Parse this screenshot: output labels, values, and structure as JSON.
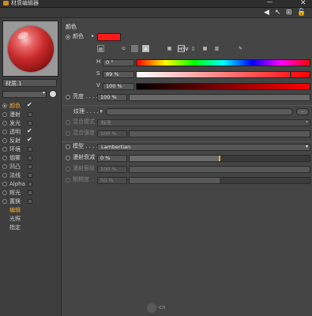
{
  "window": {
    "title": "材质编辑器",
    "buttons": {
      "minimize": "－",
      "close": "✕"
    }
  },
  "toolbar": {
    "back": "◀",
    "arrow": "↖",
    "pin": "⊞",
    "lock": "🔓"
  },
  "material": {
    "name": "材质.1"
  },
  "channels": [
    {
      "label": "颜色",
      "checked": true,
      "active": true
    },
    {
      "label": "漫射",
      "checked": false
    },
    {
      "label": "发光",
      "checked": false
    },
    {
      "label": "透明",
      "checked": true
    },
    {
      "label": "反射",
      "checked": true
    },
    {
      "label": "环境",
      "checked": false
    },
    {
      "label": "烟雾",
      "checked": false
    },
    {
      "label": "凹凸",
      "checked": false
    },
    {
      "label": "法线",
      "checked": false
    },
    {
      "label": "Alpha",
      "checked": false
    },
    {
      "label": "辉光",
      "checked": false
    },
    {
      "label": "置换",
      "checked": false
    }
  ],
  "subitems": [
    {
      "label": "编辑",
      "active": true
    },
    {
      "label": "光照",
      "active": false
    },
    {
      "label": "指定",
      "active": false
    }
  ],
  "color_section": {
    "title": "颜色",
    "color_label": "颜色",
    "color_hex": "#ff1a1a",
    "h_label": "H",
    "h_value": "0 °",
    "s_label": "S",
    "s_value": "89 %",
    "s_fraction": 0.89,
    "v_label": "V",
    "v_value": "100 %",
    "v_fraction": 1.0,
    "brightness_label": "亮度 . . . .",
    "brightness_value": "100 %",
    "brightness_fraction": 1.0
  },
  "texture_section": {
    "texture_label": "纹理 . . . . .",
    "more_button": "...",
    "blend_mode_label": "混合模式",
    "blend_mode_value": "标准",
    "blend_strength_label": "混合强度",
    "blend_strength_value": "100 %",
    "blend_strength_fraction": 1.0
  },
  "model_section": {
    "model_label": "模型 . . . .",
    "model_value": "Lambertian",
    "diffuse_falloff_label": "漫射衰减",
    "diffuse_falloff_value": "0 %",
    "diffuse_falloff_fraction": 0.0,
    "diffuse_level_label": "漫射层级",
    "diffuse_level_value": "100 %",
    "diffuse_level_fraction": 1.0,
    "roughness_label": "粗糙度. .",
    "roughness_value": "50 %",
    "roughness_fraction": 0.5
  },
  "watermark": "·cn"
}
